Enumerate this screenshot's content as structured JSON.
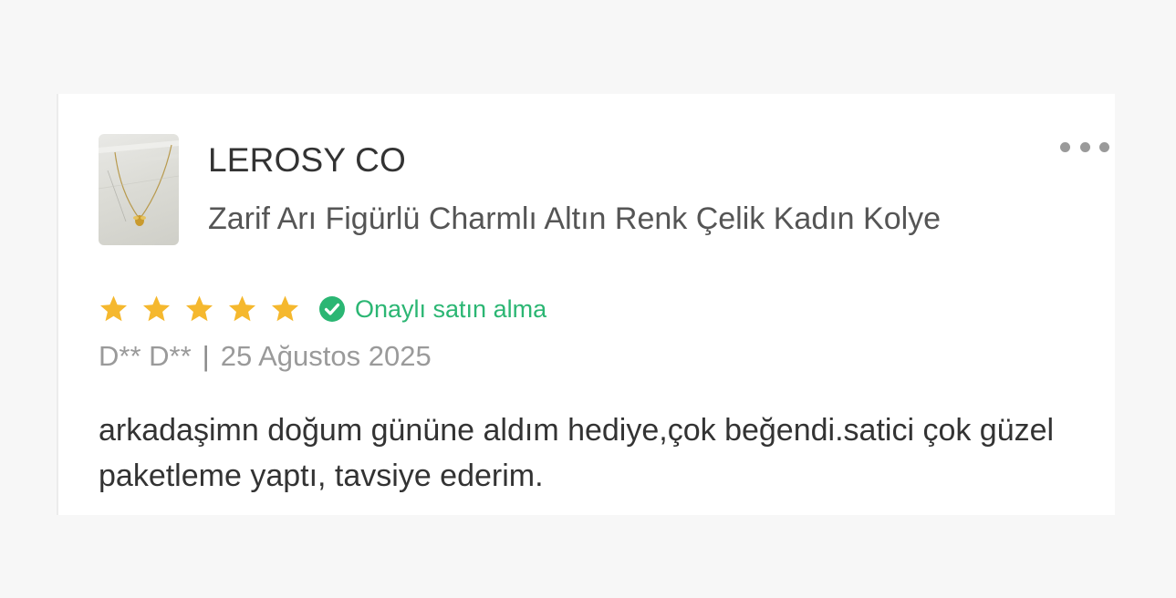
{
  "review": {
    "seller_name": "LEROSY CO",
    "product_title": "Zarif Arı Figürlü Charmlı Altın Renk Çelik Kadın Kolye",
    "rating": 5,
    "rating_max": 5,
    "verified_label": "Onaylı satın alma",
    "author": "D** D**",
    "separator": "|",
    "date": "25 Ağustos 2025",
    "body": "arkadaşimn doğum gününe aldım hediye,çok beğendi.satici çok güzel paketleme yaptı, tavsiye ederim."
  },
  "icons": {
    "more": "more-horizontal-icon",
    "star": "star-icon",
    "verified": "check-circle-icon"
  },
  "colors": {
    "star": "#f5b82e",
    "verified": "#2bb673",
    "muted_text": "#9a9a9a",
    "body_text": "#333333",
    "background": "#f7f7f7",
    "card": "#ffffff"
  }
}
